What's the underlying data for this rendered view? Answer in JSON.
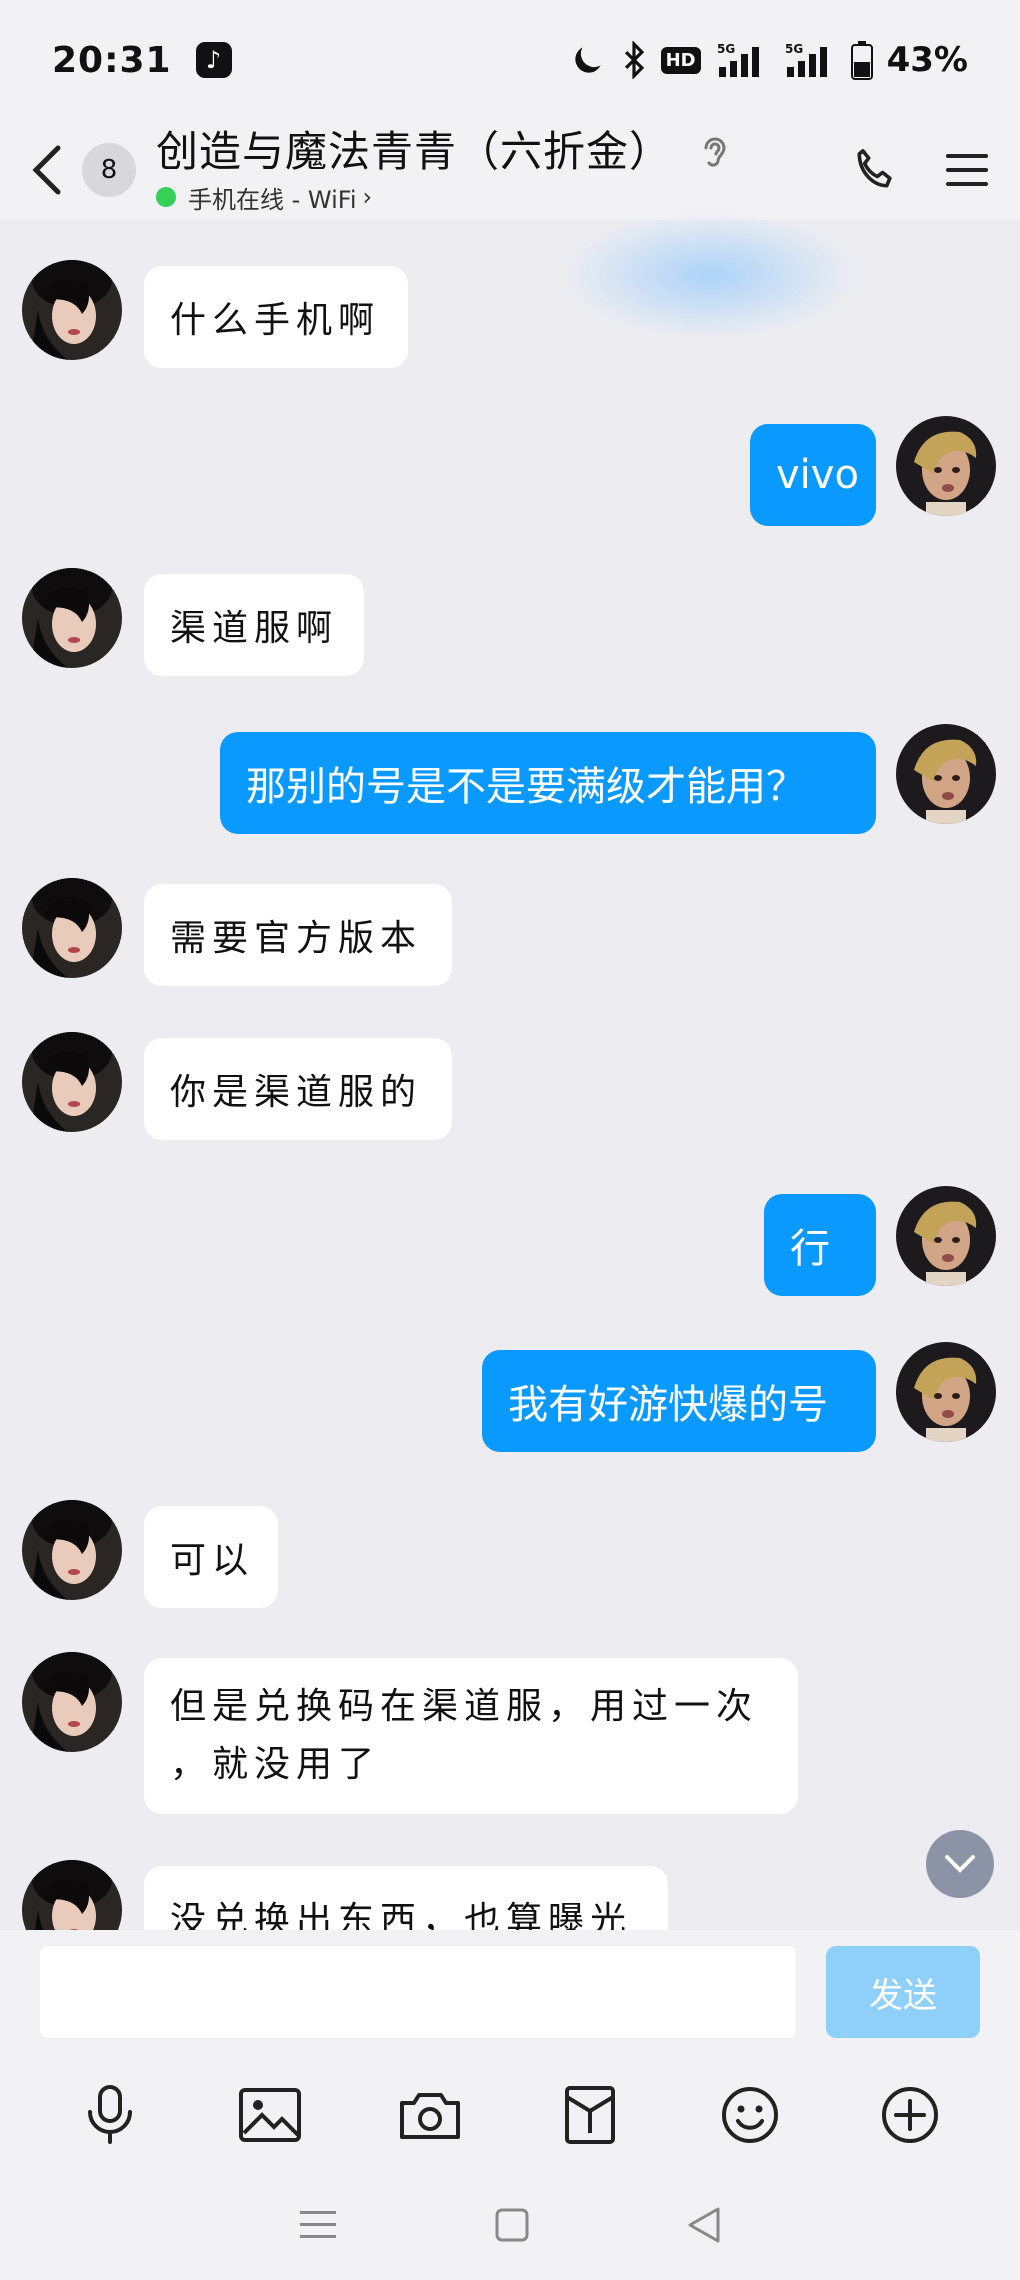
{
  "status_bar": {
    "time": "20:31",
    "hd": "HD",
    "battery": "43%"
  },
  "header": {
    "unread_count": "8",
    "title": "创造与魔法青青（六折金）",
    "online_status": "手机在线 - WiFi",
    "icons": [
      "back-icon",
      "ear-icon",
      "phone-icon",
      "menu-icon"
    ]
  },
  "messages": [
    {
      "side": "in",
      "text": "什么手机啊"
    },
    {
      "side": "out",
      "text": "vivo"
    },
    {
      "side": "in",
      "text": "渠道服啊"
    },
    {
      "side": "out",
      "text": "那别的号是不是要满级才能用？"
    },
    {
      "side": "in",
      "text": "需要官方版本"
    },
    {
      "side": "in",
      "text": "你是渠道服的"
    },
    {
      "side": "out",
      "text": "行"
    },
    {
      "side": "out",
      "text": "我有好游快爆的号"
    },
    {
      "side": "in",
      "text": "可以"
    },
    {
      "side": "in",
      "lines": [
        "但是兑换码在渠道服，用过一次",
        "，就没用了"
      ]
    },
    {
      "side": "in",
      "text": "没兑换出东西，也算曝光"
    }
  ],
  "composer": {
    "input_value": "",
    "send_label": "发送"
  },
  "toolbar_icons": [
    "mic-icon",
    "image-icon",
    "camera-icon",
    "red-packet-icon",
    "emoji-icon",
    "plus-icon"
  ],
  "colors": {
    "outgoing_bubble": "#0a99ff",
    "incoming_bubble": "#ffffff",
    "background": "#ededf1",
    "send_button": "#8fd0fb"
  }
}
